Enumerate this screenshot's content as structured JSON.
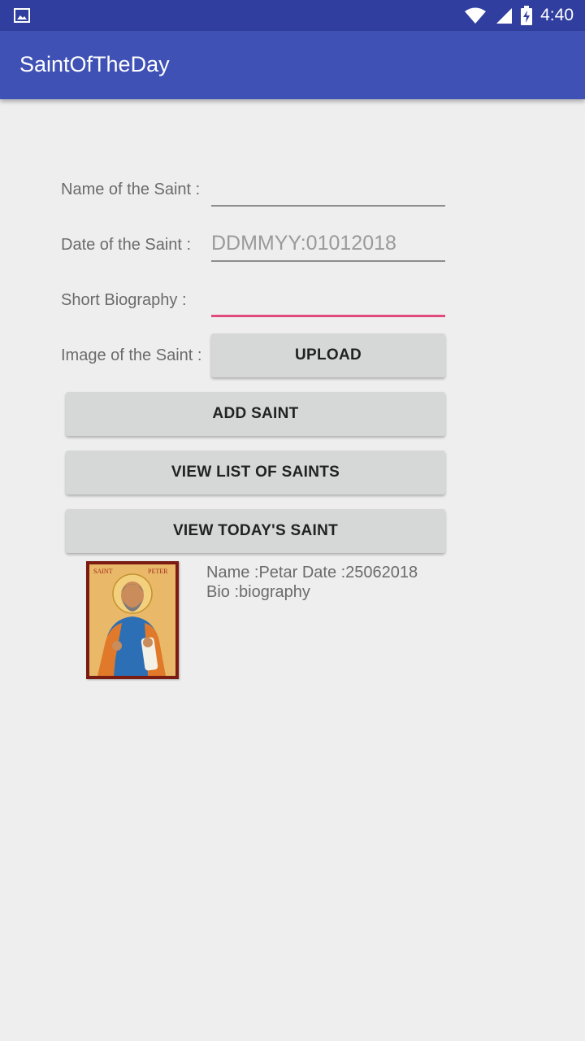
{
  "status_bar": {
    "time": "4:40",
    "icons": [
      "image-notification-icon",
      "wifi-icon",
      "cell-signal-icon",
      "battery-charging-icon"
    ]
  },
  "app_bar": {
    "title": "SaintOfTheDay"
  },
  "form": {
    "name_label": "Name of the Saint :",
    "name_value": "",
    "date_label": "Date of the Saint :",
    "date_placeholder": "DDMMYY:01012018",
    "bio_label": "Short Biography :",
    "bio_value": "",
    "image_label": "Image of the Saint :",
    "upload_button": "UPLOAD"
  },
  "actions": {
    "add_saint": "ADD SAINT",
    "view_list": "VIEW LIST OF SAINTS",
    "view_today": "VIEW TODAY'S SAINT"
  },
  "result": {
    "image_caption_left": "SAINT",
    "image_caption_right": "PETER",
    "line1": "Name :Petar Date :25062018",
    "line2": "Bio :biography"
  },
  "colors": {
    "status_bar": "#303f9f",
    "app_bar": "#3f51b5",
    "background": "#eeeeee",
    "focus_accent": "#e04a7e",
    "button": "#d6d7d7"
  }
}
